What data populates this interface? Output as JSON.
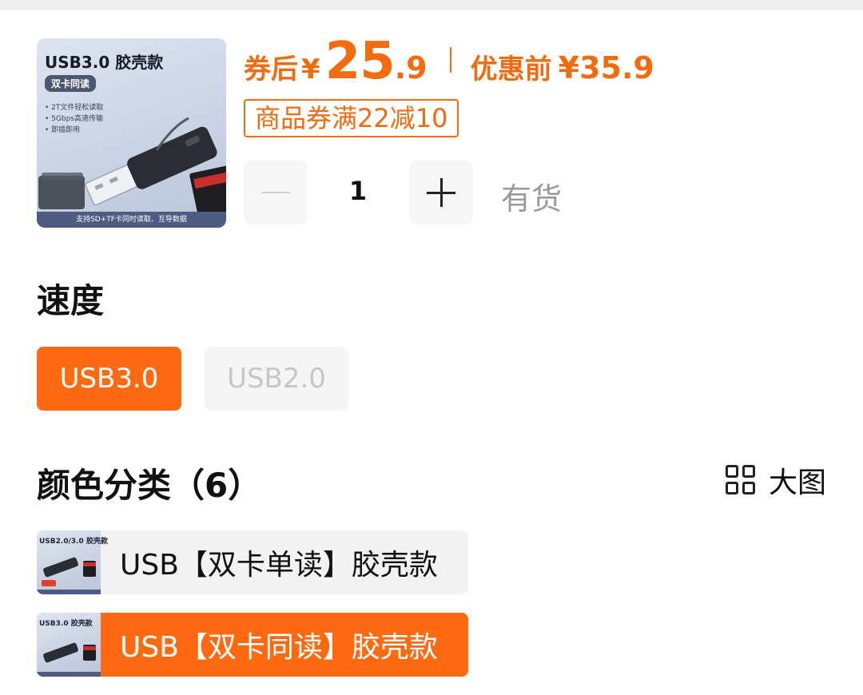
{
  "product": {
    "image": {
      "title": "USB3.0 胶壳款",
      "badge": "双卡同读",
      "features": [
        "2T文件轻松读取",
        "5Gbps高速传输",
        "即插即用"
      ],
      "footer": "支持SD+TF卡同时读取、互导数据"
    },
    "price": {
      "after_label": "券后",
      "currency": "¥",
      "after_int": "25",
      "after_dec": ".9",
      "before_label": "优惠前",
      "before_price": "¥35.9",
      "accent_color": "#f26b0f"
    },
    "coupon": "商品券满22减10",
    "quantity": {
      "value": "1",
      "minus_icon": "minus-icon",
      "plus_icon": "plus-icon"
    },
    "stock": "有货"
  },
  "speed": {
    "title": "速度",
    "options": [
      {
        "label": "USB3.0",
        "selected": true
      },
      {
        "label": "USB2.0",
        "selected": false,
        "disabled": true
      }
    ]
  },
  "color": {
    "title": "颜色分类（6）",
    "big_view_label": "大图",
    "big_view_icon": "grid-icon",
    "variants": [
      {
        "label": "USB【双卡单读】胶壳款",
        "thumb_title": "USB2.0/3.0 胶壳款",
        "selected": false
      },
      {
        "label": "USB【双卡同读】胶壳款",
        "thumb_title": "USB3.0 胶壳款",
        "selected": true
      }
    ],
    "selected_color": "#ff6a10"
  }
}
